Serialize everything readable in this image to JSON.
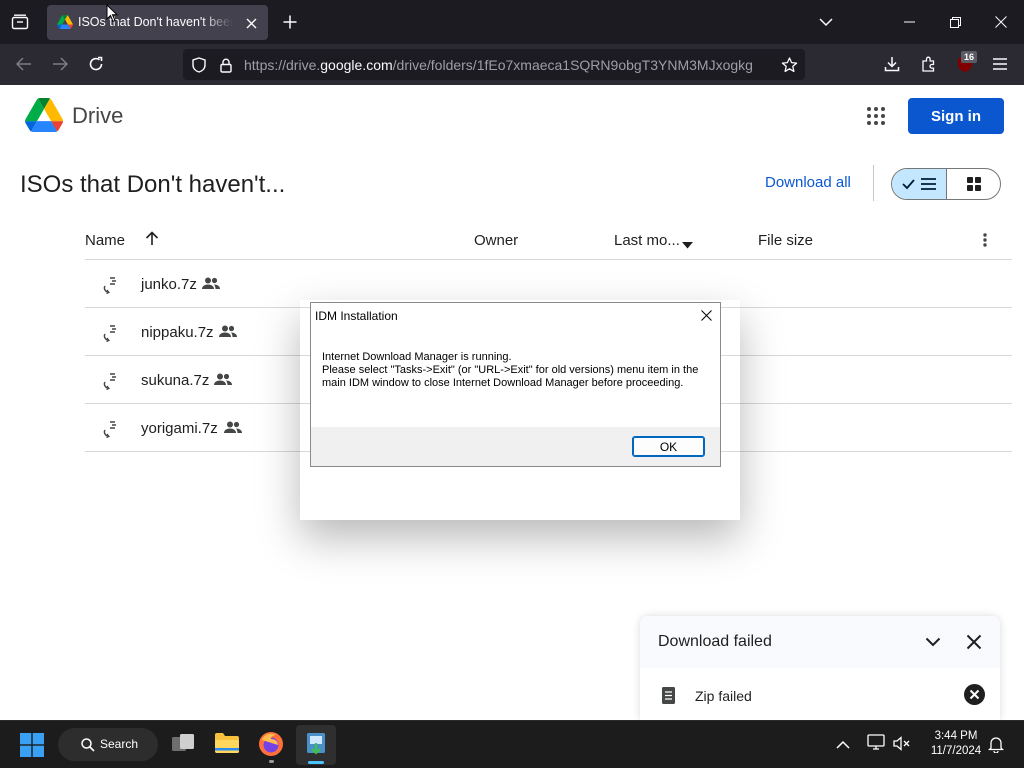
{
  "browser": {
    "tab_title": "ISOs that Don't haven't been",
    "url_prefix": "https://drive.",
    "url_host": "google.com",
    "url_path": "/drive/folders/1fEo7xmaeca1SQRN9obgT3YNM3MJxogkg",
    "notification_badge": "16"
  },
  "drive": {
    "brand": "Drive",
    "signin_label": "Sign in",
    "folder_title": "ISOs that Don't haven't...",
    "download_all": "Download all",
    "columns": {
      "name": "Name",
      "owner": "Owner",
      "modified": "Last mo...",
      "size": "File size"
    },
    "files": [
      {
        "name": "junko.7z"
      },
      {
        "name": "nippaku.7z"
      },
      {
        "name": "sukuna.7z"
      },
      {
        "name": "yorigami.7z"
      }
    ]
  },
  "dialog": {
    "title": "IDM Installation",
    "line1": "Internet Download Manager is running.",
    "line2": "Please select \"Tasks->Exit\" (or \"URL->Exit\" for old versions) menu item in the main IDM window to close Internet Download Manager before proceeding.",
    "ok_label": "OK"
  },
  "download_panel": {
    "title": "Download failed",
    "file_label": "Zip failed"
  },
  "taskbar": {
    "search_label": "Search",
    "time": "3:44 PM",
    "date": "11/7/2024"
  }
}
